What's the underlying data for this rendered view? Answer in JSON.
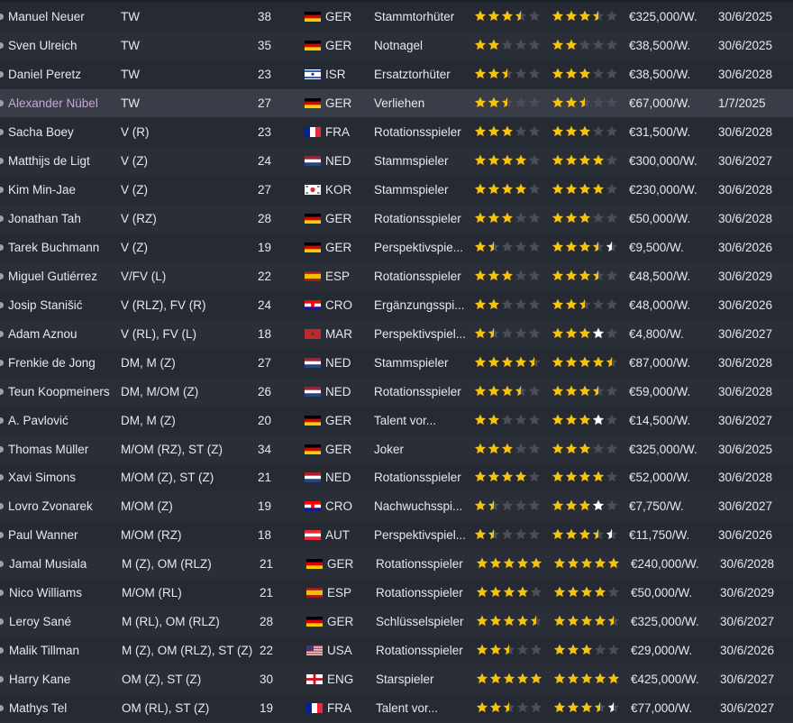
{
  "colors": {
    "row_odd": "#262a33",
    "row_even": "#2a2e37",
    "row_selected": "#393d47",
    "star_gold": "#f5c211",
    "star_empty": "#4a4e58",
    "star_white": "#ffffff",
    "loan_name": "#c7a6d8"
  },
  "icons": {
    "star": "rating-star-icon",
    "half_star": "rating-half-star-icon",
    "white_star": "potential-star-icon",
    "status_dot": "status-dot-icon"
  },
  "players": [
    {
      "name": "Manuel Neuer",
      "position": "TW",
      "age": "38",
      "nationality": "GER",
      "flag": "GER",
      "role": "Stammtorhüter",
      "current_ability": 3.5,
      "potential_ability": 3.5,
      "wage": "€325,000/W.",
      "contract_expiry": "30/6/2025"
    },
    {
      "name": "Sven Ulreich",
      "position": "TW",
      "age": "35",
      "nationality": "GER",
      "flag": "GER",
      "role": "Notnagel",
      "current_ability": 2,
      "potential_ability": 2,
      "wage": "€38,500/W.",
      "contract_expiry": "30/6/2025"
    },
    {
      "name": "Daniel Peretz",
      "position": "TW",
      "age": "23",
      "nationality": "ISR",
      "flag": "ISR",
      "role": "Ersatztorhüter",
      "current_ability": 2.5,
      "potential_ability": 3,
      "wage": "€38,500/W.",
      "contract_expiry": "30/6/2028"
    },
    {
      "name": "Alexander Nübel",
      "position": "TW",
      "age": "27",
      "nationality": "GER",
      "flag": "GER",
      "role": "Verliehen",
      "current_ability": 2.5,
      "potential_ability": 2.5,
      "wage": "€67,000/W.",
      "contract_expiry": "1/7/2025",
      "on_loan": true,
      "selected": true
    },
    {
      "name": "Sacha Boey",
      "position": "V (R)",
      "age": "23",
      "nationality": "FRA",
      "flag": "FRA",
      "role": "Rotationsspieler",
      "current_ability": 3,
      "potential_ability": 3,
      "wage": "€31,500/W.",
      "contract_expiry": "30/6/2028"
    },
    {
      "name": "Matthijs de Ligt",
      "position": "V (Z)",
      "age": "24",
      "nationality": "NED",
      "flag": "NED",
      "role": "Stammspieler",
      "current_ability": 4,
      "potential_ability": 4,
      "wage": "€300,000/W.",
      "contract_expiry": "30/6/2027"
    },
    {
      "name": "Kim Min-Jae",
      "position": "V (Z)",
      "age": "27",
      "nationality": "KOR",
      "flag": "KOR",
      "role": "Stammspieler",
      "current_ability": 4,
      "potential_ability": 4,
      "wage": "€230,000/W.",
      "contract_expiry": "30/6/2028"
    },
    {
      "name": "Jonathan Tah",
      "position": "V (RZ)",
      "age": "28",
      "nationality": "GER",
      "flag": "GER",
      "role": "Rotationsspieler",
      "current_ability": 3,
      "potential_ability": 3,
      "wage": "€50,000/W.",
      "contract_expiry": "30/6/2028"
    },
    {
      "name": "Tarek Buchmann",
      "position": "V (Z)",
      "age": "19",
      "nationality": "GER",
      "flag": "GER",
      "role": "Perspektivspie...",
      "current_ability": 1.5,
      "potential_ability": 3.5,
      "potential_max": 4.5,
      "wage": "€9,500/W.",
      "contract_expiry": "30/6/2026"
    },
    {
      "name": "Miguel Gutiérrez",
      "position": "V/FV (L)",
      "age": "22",
      "nationality": "ESP",
      "flag": "ESP",
      "role": "Rotationsspieler",
      "current_ability": 3,
      "potential_ability": 3.5,
      "wage": "€48,500/W.",
      "contract_expiry": "30/6/2029"
    },
    {
      "name": "Josip Stanišić",
      "position": "V (RLZ), FV (R)",
      "age": "24",
      "nationality": "CRO",
      "flag": "CRO",
      "role": "Ergänzungsspi...",
      "current_ability": 2,
      "potential_ability": 2.5,
      "wage": "€48,000/W.",
      "contract_expiry": "30/6/2026"
    },
    {
      "name": "Adam Aznou",
      "position": "V (RL), FV (L)",
      "age": "18",
      "nationality": "MAR",
      "flag": "MAR",
      "role": "Perspektivspiel...",
      "current_ability": 1.5,
      "potential_ability": 3,
      "potential_max": 4,
      "wage": "€4,800/W.",
      "contract_expiry": "30/6/2027"
    },
    {
      "name": "Frenkie de Jong",
      "position": "DM, M (Z)",
      "age": "27",
      "nationality": "NED",
      "flag": "NED",
      "role": "Stammspieler",
      "current_ability": 4.5,
      "potential_ability": 4.5,
      "wage": "€87,000/W.",
      "contract_expiry": "30/6/2028"
    },
    {
      "name": "Teun Koopmeiners",
      "position": "DM, M/OM (Z)",
      "age": "26",
      "nationality": "NED",
      "flag": "NED",
      "role": "Rotationsspieler",
      "current_ability": 3.5,
      "potential_ability": 3.5,
      "wage": "€59,000/W.",
      "contract_expiry": "30/6/2028"
    },
    {
      "name": "A. Pavlović",
      "position": "DM, M (Z)",
      "age": "20",
      "nationality": "GER",
      "flag": "GER",
      "role": "Talent vor...",
      "current_ability": 2,
      "potential_ability": 3,
      "potential_max": 4,
      "wage": "€14,500/W.",
      "contract_expiry": "30/6/2027"
    },
    {
      "name": "Thomas Müller",
      "position": "M/OM (RZ), ST (Z)",
      "age": "34",
      "nationality": "GER",
      "flag": "GER",
      "role": "Joker",
      "current_ability": 3,
      "potential_ability": 3,
      "wage": "€325,000/W.",
      "contract_expiry": "30/6/2025"
    },
    {
      "name": "Xavi Simons",
      "position": "M/OM (Z), ST (Z)",
      "age": "21",
      "nationality": "NED",
      "flag": "NED",
      "role": "Rotationsspieler",
      "current_ability": 4,
      "potential_ability": 4,
      "wage": "€52,000/W.",
      "contract_expiry": "30/6/2028"
    },
    {
      "name": "Lovro Zvonarek",
      "position": "M/OM (Z)",
      "age": "19",
      "nationality": "CRO",
      "flag": "CRO",
      "role": "Nachwuchsspi...",
      "current_ability": 1.5,
      "potential_ability": 3,
      "potential_max": 4,
      "wage": "€7,750/W.",
      "contract_expiry": "30/6/2027"
    },
    {
      "name": "Paul Wanner",
      "position": "M/OM (RZ)",
      "age": "18",
      "nationality": "AUT",
      "flag": "AUT",
      "role": "Perspektivspiel...",
      "current_ability": 1.5,
      "potential_ability": 3.5,
      "potential_max": 4.5,
      "wage": "€11,750/W.",
      "contract_expiry": "30/6/2026"
    },
    {
      "name": "Jamal Musiala",
      "position": "M (Z), OM (RLZ)",
      "age": "21",
      "nationality": "GER",
      "flag": "GER",
      "role": "Rotationsspieler",
      "current_ability": 5,
      "potential_ability": 5,
      "wage": "€240,000/W.",
      "contract_expiry": "30/6/2028"
    },
    {
      "name": "Nico Williams",
      "position": "M/OM (RL)",
      "age": "21",
      "nationality": "ESP",
      "flag": "ESP",
      "role": "Rotationsspieler",
      "current_ability": 4,
      "potential_ability": 4,
      "wage": "€50,000/W.",
      "contract_expiry": "30/6/2029"
    },
    {
      "name": "Leroy Sané",
      "position": "M (RL), OM (RLZ)",
      "age": "28",
      "nationality": "GER",
      "flag": "GER",
      "role": "Schlüsselspieler",
      "current_ability": 4.5,
      "potential_ability": 4.5,
      "wage": "€325,000/W.",
      "contract_expiry": "30/6/2027"
    },
    {
      "name": "Malik Tillman",
      "position": "M (Z), OM (RLZ), ST (Z)",
      "age": "22",
      "nationality": "USA",
      "flag": "USA",
      "role": "Rotationsspieler",
      "current_ability": 2.5,
      "potential_ability": 3,
      "wage": "€29,000/W.",
      "contract_expiry": "30/6/2026"
    },
    {
      "name": "Harry Kane",
      "position": "OM (Z), ST (Z)",
      "age": "30",
      "nationality": "ENG",
      "flag": "ENG",
      "role": "Starspieler",
      "current_ability": 5,
      "potential_ability": 5,
      "wage": "€425,000/W.",
      "contract_expiry": "30/6/2027"
    },
    {
      "name": "Mathys Tel",
      "position": "OM (RL), ST (Z)",
      "age": "19",
      "nationality": "FRA",
      "flag": "FRA",
      "role": "Talent vor...",
      "current_ability": 2.5,
      "potential_ability": 3.5,
      "potential_max": 4.5,
      "wage": "€77,000/W.",
      "contract_expiry": "30/6/2027"
    }
  ]
}
